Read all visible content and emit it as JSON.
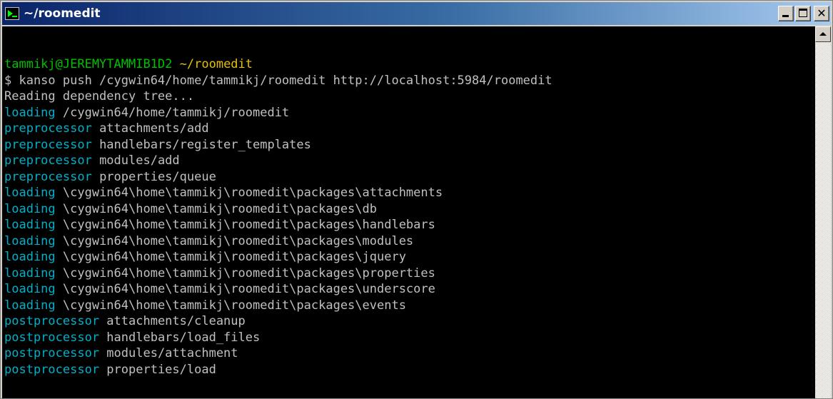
{
  "window": {
    "title": "~/roomedit",
    "icon": "terminal-icon",
    "controls": [
      "minimize",
      "maximize",
      "close"
    ]
  },
  "colors": {
    "titlebar_start": "#0a246a",
    "titlebar_end": "#a6caf0",
    "console_bg": "#000000",
    "prompt_user": "#00c000",
    "prompt_path": "#e5c000",
    "keyword": "#00b0c8",
    "text": "#c0c0c0"
  },
  "terminal": {
    "prompt": {
      "user_host": "tammikj@JEREMYTAMMIB1D2",
      "path": "~/roomedit"
    },
    "command": "$ kanso push /cygwin64/home/tammikj/roomedit http://localhost:5984/roomedit",
    "lines": [
      {
        "keyword": "",
        "text": "Reading dependency tree..."
      },
      {
        "keyword": "loading",
        "text": " /cygwin64/home/tammikj/roomedit"
      },
      {
        "keyword": "preprocessor",
        "text": " attachments/add"
      },
      {
        "keyword": "preprocessor",
        "text": " handlebars/register_templates"
      },
      {
        "keyword": "preprocessor",
        "text": " modules/add"
      },
      {
        "keyword": "preprocessor",
        "text": " properties/queue"
      },
      {
        "keyword": "loading",
        "text": " \\cygwin64\\home\\tammikj\\roomedit\\packages\\attachments"
      },
      {
        "keyword": "loading",
        "text": " \\cygwin64\\home\\tammikj\\roomedit\\packages\\db"
      },
      {
        "keyword": "loading",
        "text": " \\cygwin64\\home\\tammikj\\roomedit\\packages\\handlebars"
      },
      {
        "keyword": "loading",
        "text": " \\cygwin64\\home\\tammikj\\roomedit\\packages\\modules"
      },
      {
        "keyword": "loading",
        "text": " \\cygwin64\\home\\tammikj\\roomedit\\packages\\jquery"
      },
      {
        "keyword": "loading",
        "text": " \\cygwin64\\home\\tammikj\\roomedit\\packages\\properties"
      },
      {
        "keyword": "loading",
        "text": " \\cygwin64\\home\\tammikj\\roomedit\\packages\\underscore"
      },
      {
        "keyword": "loading",
        "text": " \\cygwin64\\home\\tammikj\\roomedit\\packages\\events"
      },
      {
        "keyword": "postprocessor",
        "text": " attachments/cleanup"
      },
      {
        "keyword": "postprocessor",
        "text": " handlebars/load_files"
      },
      {
        "keyword": "postprocessor",
        "text": " modules/attachment"
      },
      {
        "keyword": "postprocessor",
        "text": " properties/load"
      }
    ]
  }
}
